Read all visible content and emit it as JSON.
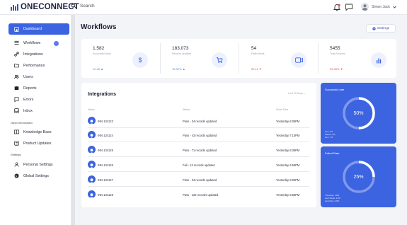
{
  "brand": {
    "name": "ONECONNECT"
  },
  "search": {
    "placeholder": "Search"
  },
  "user": {
    "name": "Simon Jack"
  },
  "sidebar": {
    "active": "Dashboard",
    "items": [
      {
        "label": "Workflows",
        "icon": "list-icon"
      },
      {
        "label": "Integrations",
        "icon": "link-icon"
      },
      {
        "label": "Performance",
        "icon": "folder-icon"
      },
      {
        "label": "Users",
        "icon": "users-icon"
      },
      {
        "label": "Reports",
        "icon": "reports-icon"
      },
      {
        "label": "Errors",
        "icon": "errors-icon"
      },
      {
        "label": "Inbox",
        "icon": "inbox-icon"
      }
    ],
    "section_other": "Other information",
    "other_items": [
      {
        "label": "Knowledge Base",
        "icon": "book-icon"
      },
      {
        "label": "Product Updates",
        "icon": "updates-icon"
      }
    ],
    "section_settings": "Settings",
    "settings_items": [
      {
        "label": "Personal Settings",
        "icon": "person-icon"
      },
      {
        "label": "Global Settings",
        "icon": "globe-icon"
      }
    ]
  },
  "page": {
    "title": "Workflows",
    "settings_label": "Settings"
  },
  "stats": [
    {
      "value": "1,582",
      "label": "Successful flows",
      "trend": "12.45",
      "direction": "up",
      "icon": "dollar-icon"
    },
    {
      "value": "183,073",
      "label": "Records Updated",
      "trend": "15.32%",
      "direction": "up",
      "icon": "cart-icon"
    },
    {
      "value": "54",
      "label": "Failed flows",
      "trend": "22.11",
      "direction": "down",
      "icon": "camera-icon"
    },
    {
      "value": "5455",
      "label": "Total Services",
      "trend": "32.45%",
      "direction": "down",
      "icon": "chart-icon"
    }
  ],
  "integrations": {
    "title": "Integrations",
    "filter": "Last 30 Days",
    "columns": [
      "Name",
      "Status",
      "Done Time"
    ],
    "rows": [
      {
        "id": "INN 134123",
        "status": "Pass - 34 records updated",
        "time": "Yesterday 6:05PM"
      },
      {
        "id": "INN 134124",
        "status": "Pass - 43 records updated",
        "time": "Yesterday 7:10PM"
      },
      {
        "id": "INN 134125",
        "status": "Pass - 71 records updated",
        "time": "Yesterday 8:35PM"
      },
      {
        "id": "INN 134126",
        "status": "Fail - 13 records updated",
        "time": "Yesterday 6:55PM"
      },
      {
        "id": "INN 134127",
        "status": "Pass - 34 records updated",
        "time": "Yesterday 8:05PM"
      },
      {
        "id": "INN 134128",
        "status": "Pass - 122 records updated",
        "time": "Yesterday 8:55PM"
      }
    ]
  },
  "success_rate": {
    "title": "Successful rate",
    "percent": "50%",
    "fraction": 0.5,
    "lines": [
      "Nov: 1%",
      "Winter: 9%",
      "Dec: 7%"
    ]
  },
  "failed_rate": {
    "title": "Failed Rate",
    "percent": "25%",
    "fraction": 0.25,
    "lines": [
      "Thursday: 10%",
      "Last Week: 12%",
      "Last Day: 0.0%"
    ]
  },
  "colors": {
    "accent": "#3c63e0",
    "up": "#3c8fd6",
    "down": "#e0465a"
  }
}
